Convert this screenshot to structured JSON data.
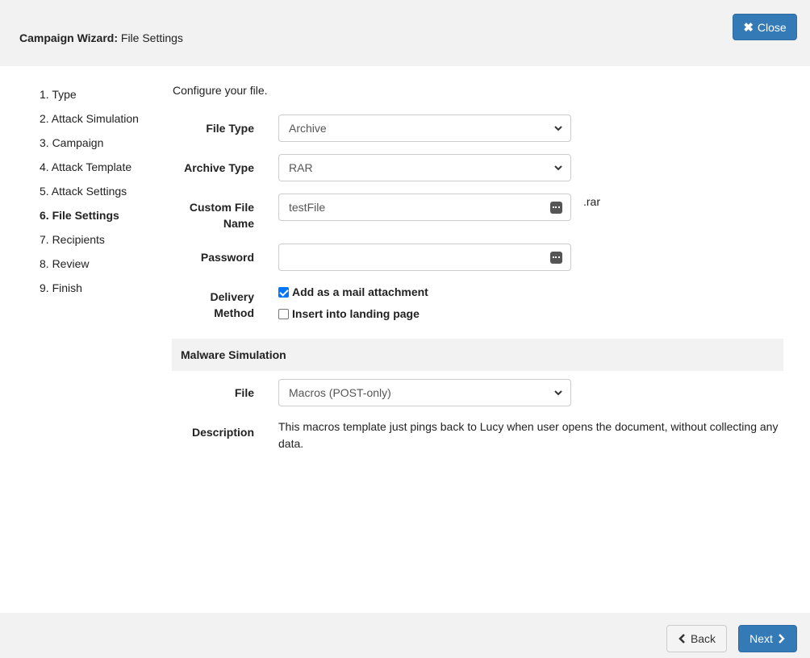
{
  "header": {
    "title_bold": "Campaign Wizard:",
    "title_rest": " File Settings",
    "close_label": "Close"
  },
  "steps": [
    {
      "label": "1. Type"
    },
    {
      "label": "2. Attack Simulation"
    },
    {
      "label": "3. Campaign"
    },
    {
      "label": "4. Attack Template"
    },
    {
      "label": "5. Attack Settings"
    },
    {
      "label": "6. File Settings",
      "active": true
    },
    {
      "label": "7. Recipients"
    },
    {
      "label": "8. Review"
    },
    {
      "label": "9. Finish"
    }
  ],
  "form": {
    "intro": "Configure your file.",
    "file_type": {
      "label": "File Type",
      "value": "Archive"
    },
    "archive_type": {
      "label": "Archive Type",
      "value": "RAR"
    },
    "custom_file_name": {
      "label_line1": "Custom File",
      "label_line2": "Name",
      "value": "testFile",
      "suffix": ".rar"
    },
    "password": {
      "label": "Password",
      "value": ""
    },
    "delivery_method": {
      "label_line1": "Delivery",
      "label_line2": "Method",
      "options": [
        {
          "label": "Add as a mail attachment",
          "checked": true
        },
        {
          "label": "Insert into landing page",
          "checked": false
        }
      ]
    }
  },
  "malware": {
    "section_title": "Malware Simulation",
    "file": {
      "label": "File",
      "value": "Macros (POST-only)"
    },
    "description": {
      "label": "Description",
      "text": "This macros template just pings back to Lucy when user opens the document, without collecting any data."
    }
  },
  "footer": {
    "back_label": "Back",
    "next_label": "Next"
  },
  "colors": {
    "primary": "#337ab7",
    "checkbox": "#0075ff",
    "panel_bg": "#f2f2f2"
  }
}
